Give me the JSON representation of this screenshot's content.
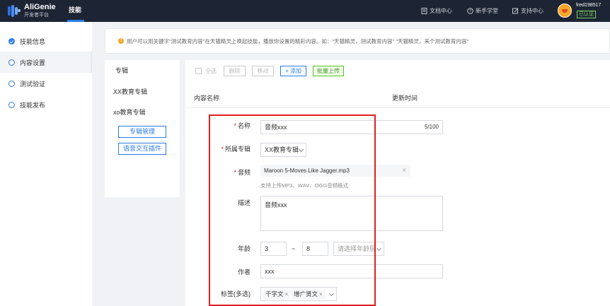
{
  "app": {
    "name": "AliGenie",
    "subtitle": "开发者平台",
    "nav_active": "技能"
  },
  "topbar": {
    "links": [
      {
        "label": "文档中心",
        "icon": "document-icon"
      },
      {
        "label": "新手学堂",
        "icon": "help-circle-icon"
      },
      {
        "label": "支持中心",
        "icon": "support-icon"
      }
    ],
    "user": {
      "name": "fred198517",
      "badge": "已认证"
    }
  },
  "sidebar": {
    "items": [
      {
        "label": "技能信息",
        "state": "done"
      },
      {
        "label": "内容设置",
        "state": "active"
      },
      {
        "label": "测试验证",
        "state": "todo"
      },
      {
        "label": "技能发布",
        "state": "todo"
      }
    ]
  },
  "notice": {
    "text": "用户可以用关键字\"测试教育内容\"在天猫精灵上唤起技能，播放你设置的精彩内容。如：\"天猫精灵，测试教育内容\" \"天猫精灵，来个测试教育内容\""
  },
  "albums": {
    "header": "专辑",
    "items": [
      "XX教育专辑",
      "xo教育专辑"
    ],
    "manage_button": "专辑管理",
    "plugin_button": "语音交互插件"
  },
  "toolbar": {
    "select_all": "全选",
    "delete": "删除",
    "move": "移动",
    "add": "+ 添加",
    "batch_upload": "批量上传"
  },
  "columns": {
    "name": "内容名称",
    "updated": "更新时间"
  },
  "form": {
    "name_label": "名称",
    "name_value": "音频xxx",
    "name_count": "5/100",
    "album_label": "所属专辑",
    "album_value": "XX教育专辑",
    "audio_label": "音频",
    "audio_file": "Maroon 5-Moves Like Jagger.mp3",
    "audio_hint": "支持上传MP3、WAV、OGG音频格式",
    "desc_label": "描述",
    "desc_value": "音频xxx",
    "age_label": "年龄",
    "age_min": "3",
    "age_sep": "~",
    "age_max": "8",
    "age_range_placeholder": "请选择年龄层",
    "author_label": "作者",
    "author_value": "xxx",
    "tags_label": "标签(多选)",
    "tags": [
      "千字文",
      "增广贤文"
    ]
  }
}
